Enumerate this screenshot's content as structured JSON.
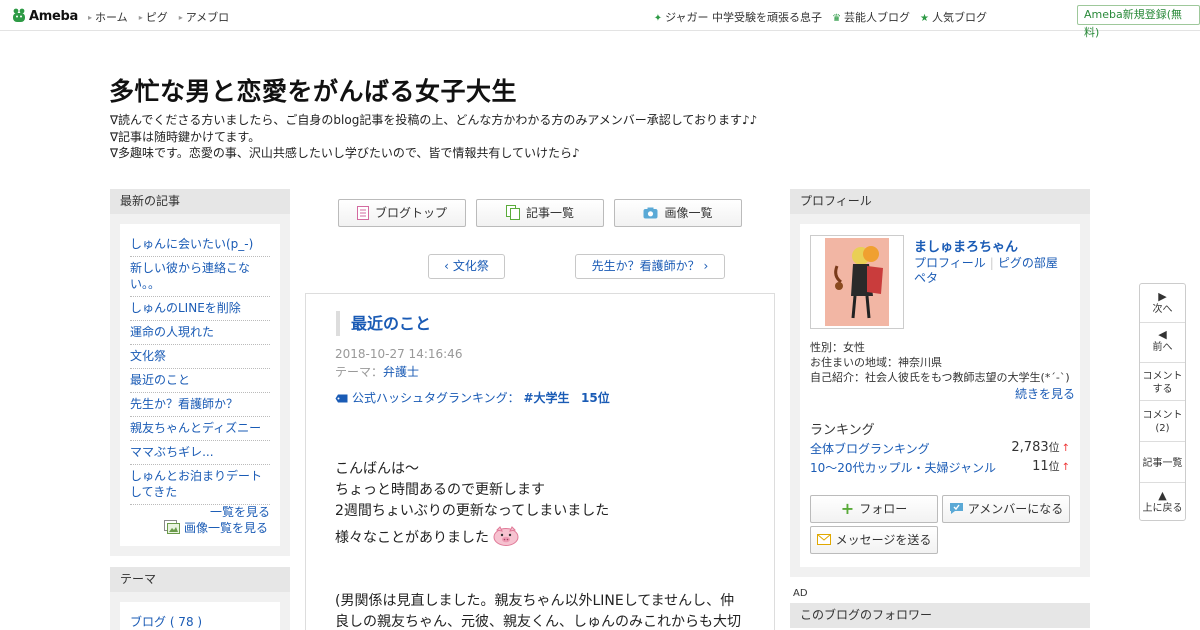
{
  "header": {
    "logo_text": "Ameba",
    "nav": [
      "ホーム",
      "ピグ",
      "アメブロ"
    ],
    "right_links": [
      {
        "icon": "sparkle-icon",
        "label": "ジャガー 中学受験を頑張る息子"
      },
      {
        "icon": "crown-icon",
        "label": "芸能人ブログ"
      },
      {
        "icon": "star-icon",
        "label": "人気ブログ"
      }
    ],
    "register_label": "Ameba新規登録(無料)"
  },
  "blog": {
    "title": "多忙な男と恋愛をがんばる女子大生",
    "description": [
      "∇読んでくださる方いましたら、ご自身のblog記事を投稿の上、どんな方かわかる方のみアメンバー承認しております♪♪",
      "∇記事は随時鍵かけてます。",
      "∇多趣味です。恋愛の事、沢山共感したいし学びたいので、皆で情報共有していけたら♪"
    ]
  },
  "left": {
    "recent_heading": "最新の記事",
    "recent_items": [
      "しゅんに会いたい(p_-)",
      "新しい彼から連絡こない。。",
      "しゅんのLINEを削除",
      "運命の人現れた",
      "文化祭",
      "最近のこと",
      "先生か？看護師か？",
      "親友ちゃんとディズニー",
      "ママぶちギレ...",
      "しゅんとお泊まりデートしてきた"
    ],
    "see_list": "一覧を見る",
    "see_images": "画像一覧を見る",
    "theme_heading": "テーマ",
    "theme_item": "ブログ ( 78 )"
  },
  "center": {
    "tabs": [
      {
        "icon": "document-icon",
        "label": "ブログトップ"
      },
      {
        "icon": "pages-icon",
        "label": "記事一覧"
      },
      {
        "icon": "camera-icon",
        "label": "画像一覧"
      }
    ],
    "prev_article": "文化祭",
    "next_article": "先生か？看護師か？",
    "article": {
      "title": "最近のこと",
      "date": "2018-10-27 14:16:46",
      "theme_prefix": "テーマ：",
      "theme": "弁護士",
      "ranking_label": "公式ハッシュタグランキング：",
      "ranking_tag": "#大学生",
      "ranking_rank": "15位",
      "body": [
        "こんばんは〜",
        "ちょっと時間あるので更新します",
        "2週間ちょいぶりの更新なってしまいました",
        "様々なことがありました"
      ],
      "body2": "(男関係は見直しました。親友ちゃん以外LINEしてませんし、仲良しの親友ちゃん、元彼、親友くん、しゅんのみこれからも大切"
    }
  },
  "right": {
    "profile_heading": "プロフィール",
    "name": "ましゅまろちゃん",
    "links": [
      "プロフィール",
      "ピグの部屋"
    ],
    "peta": "ペタ",
    "gender": "性別：女性",
    "region": "お住まいの地域：神奈川県",
    "intro": "自己紹介：社会人彼氏をもつ教師志望の大学生(*´-`)",
    "more": "続きを見る",
    "ranking_title": "ランキング",
    "rankings": [
      {
        "label": "全体ブログランキング",
        "value": "2,783",
        "unit": "位",
        "trend": "↑"
      },
      {
        "label": "10〜20代カップル・夫婦ジャンル",
        "value": "11",
        "unit": "位",
        "trend": "↑"
      }
    ],
    "follow": "フォロー",
    "member": "アメンバーになる",
    "message": "メッセージを送る",
    "ad": "AD",
    "followers_heading": "このブログのフォロワー"
  },
  "float_nav": {
    "next": "次へ",
    "prev": "前へ",
    "comment_write": [
      "コメント",
      "する"
    ],
    "comment_count": [
      "コメント",
      "(2)"
    ],
    "article_list": "記事一覧",
    "top": "上に戻る"
  },
  "colors": {
    "link": "#1a5bb5",
    "brand_green": "#2d9a45"
  }
}
